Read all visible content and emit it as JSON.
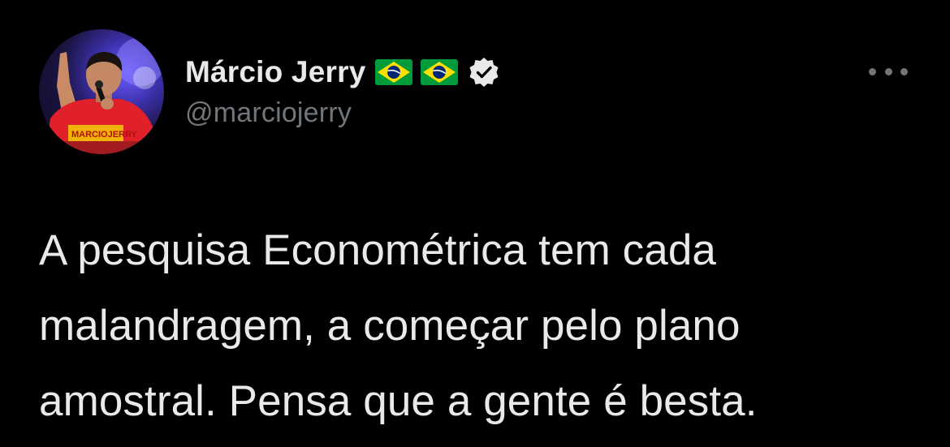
{
  "tweet": {
    "author": {
      "name": "Márcio Jerry",
      "handle": "@marciojerry",
      "name_emojis": [
        "brazil-flag",
        "brazil-flag"
      ],
      "verified": true
    },
    "text_lines": [
      "A pesquisa Econométrica tem cada",
      "malandragem, a começar pelo plano",
      "amostral. Pensa que a gente é besta."
    ]
  },
  "icons": {
    "more": "more-horizontal-icon",
    "verified": "verified-badge-icon",
    "flag": "brazil-flag-icon"
  },
  "colors": {
    "background": "#000000",
    "text_primary": "#e7e9ea",
    "text_secondary": "#71767b",
    "flag_green": "#009c3b",
    "flag_yellow": "#ffdf00",
    "flag_blue": "#002776"
  }
}
